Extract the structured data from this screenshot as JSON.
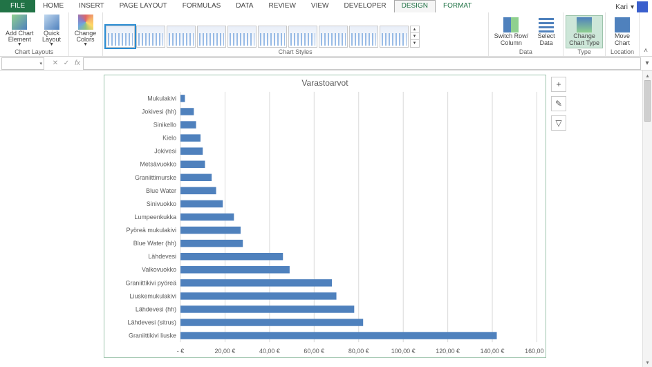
{
  "tabs": {
    "file": "FILE",
    "items": [
      "HOME",
      "INSERT",
      "PAGE LAYOUT",
      "FORMULAS",
      "DATA",
      "REVIEW",
      "VIEW",
      "DEVELOPER"
    ],
    "context": [
      "DESIGN",
      "FORMAT"
    ],
    "active": "DESIGN",
    "account_name": "Kari",
    "account_dd": "▾"
  },
  "ribbon": {
    "chart_layouts": {
      "add_chart_element": "Add Chart\nElement",
      "quick_layout": "Quick\nLayout",
      "group": "Chart Layouts"
    },
    "change_colors": {
      "label": "Change\nColors"
    },
    "chart_styles": {
      "group": "Chart Styles"
    },
    "data": {
      "switch": "Switch Row/\nColumn",
      "select": "Select\nData",
      "group": "Data"
    },
    "type": {
      "change": "Change\nChart Type",
      "group": "Type"
    },
    "location": {
      "move": "Move\nChart",
      "group": "Location"
    },
    "collapse": "˄"
  },
  "fx": {
    "namebox_value": "",
    "namebox_dd": "▾",
    "cancel": "✕",
    "enter": "✓",
    "fx": "fx",
    "formula": "",
    "expand": "▾"
  },
  "chart_tools": {
    "add": "+",
    "style": "✎",
    "filter": "▽"
  },
  "chart_data": {
    "type": "bar",
    "title": "Varastoarvot",
    "xlabel": "",
    "ylabel": "",
    "xlim": [
      0,
      160
    ],
    "x_ticks": [
      "-   €",
      "20,00 €",
      "40,00 €",
      "60,00 €",
      "80,00 €",
      "100,00 €",
      "120,00 €",
      "140,00 €",
      "160,00 €"
    ],
    "categories": [
      "Mukulakivi",
      "Jokivesi (hh)",
      "Sinikello",
      "Kielo",
      "Jokivesi",
      "Metsävuokko",
      "Graniittimurske",
      "Blue Water",
      "Sinivuokko",
      "Lumpeenkukka",
      "Pyöreä mukulakivi",
      "Blue Water (hh)",
      "Lähdevesi",
      "Valkovuokko",
      "Graniittikivi pyöreä",
      "Liuskemukulakivi",
      "Lähdevesi (hh)",
      "Lähdevesi (sitrus)",
      "Graniittikivi liuske"
    ],
    "values": [
      2,
      6,
      7,
      9,
      10,
      11,
      14,
      16,
      19,
      24,
      27,
      28,
      46,
      49,
      68,
      70,
      78,
      82,
      142
    ],
    "bar_color": "#4f81bd"
  }
}
